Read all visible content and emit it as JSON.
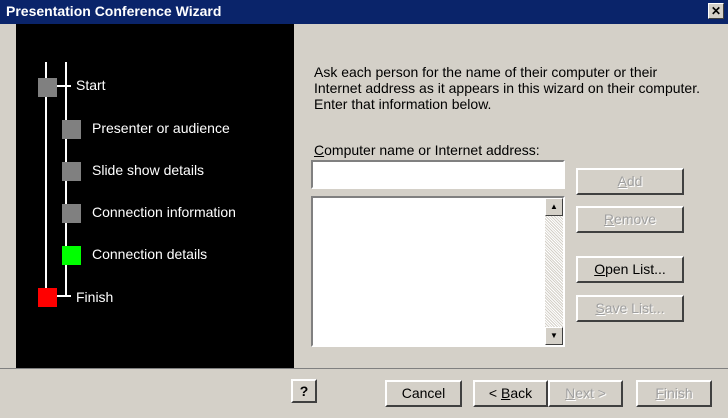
{
  "window": {
    "title": "Presentation Conference Wizard",
    "close_glyph": "✕",
    "close_icon": "close-icon"
  },
  "steps": [
    {
      "label": "Start",
      "state": "done",
      "color": "#808080"
    },
    {
      "label": "Presenter or audience",
      "state": "done",
      "color": "#808080"
    },
    {
      "label": "Slide show details",
      "state": "done",
      "color": "#808080"
    },
    {
      "label": "Connection information",
      "state": "done",
      "color": "#808080"
    },
    {
      "label": "Connection details",
      "state": "current",
      "color": "#00ff00"
    },
    {
      "label": "Finish",
      "state": "final",
      "color": "#ff0000"
    }
  ],
  "main": {
    "instructions": "Ask each person for the name of their computer or their Internet address as it appears in this wizard on their computer. Enter that information below.",
    "field_label_mnemonic": "C",
    "field_label_rest": "omputer name or Internet address:",
    "field_value": "",
    "list_items": []
  },
  "side_buttons": {
    "add": {
      "mnemonic": "A",
      "rest": "dd",
      "enabled": false
    },
    "remove": {
      "mnemonic": "R",
      "rest": "emove",
      "enabled": false
    },
    "open_list": {
      "mnemonic": "O",
      "rest": "pen List...",
      "enabled": true
    },
    "save_list": {
      "mnemonic": "S",
      "rest": "ave List...",
      "enabled": false
    }
  },
  "footer": {
    "help_label": "?",
    "help_icon": "help-icon",
    "cancel_label": "Cancel",
    "back_prefix": "< ",
    "back_mnemonic": "B",
    "back_rest": "ack",
    "next_mnemonic": "N",
    "next_rest": "ext >",
    "finish_mnemonic": "F",
    "finish_rest": "inish"
  },
  "colors": {
    "title_bar": "#0a246a",
    "step_panel": "#000000",
    "step_line": "#ffffff",
    "dialog": "#d4d0c8"
  }
}
